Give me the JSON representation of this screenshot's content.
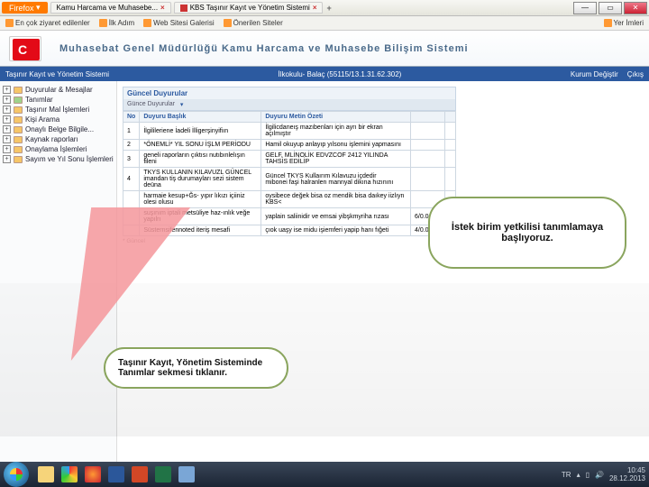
{
  "titlebar": {
    "firefox": "Firefox",
    "tabs": [
      {
        "label": "Kamu Harcama ve Muhasebe..."
      },
      {
        "label": "KBS  Taşınır Kayıt ve Yönetim Sistemi"
      }
    ]
  },
  "bookmarks": {
    "items": [
      "En çok ziyaret edilenler",
      "İlk Adım",
      "Web Sitesi Galerisi",
      "Önerilen Siteler"
    ],
    "right": "Yer İmleri"
  },
  "header": {
    "title": "Muhasebat Genel Müdürlüğü Kamu Harcama ve Muhasebe Bilişim Sistemi"
  },
  "bluebar": {
    "left": "Taşınır Kayıt ve Yönetim Sistemi",
    "center": "İlkokulu- Balaç (55115/13.1.31.62.302)",
    "r1": "Kurum Değiştir",
    "r2": "Çıkış"
  },
  "sidebar": {
    "items": [
      "Duyurular & Mesajlar",
      "Tanımlar",
      "Taşınır Mal İşlemleri",
      "Kişi Arama",
      "Onaylı Belge Bilgile...",
      "Kaynak raporları",
      "Onaylama İşlemleri",
      "Sayım ve Yıl Sonu İşlemleri"
    ]
  },
  "content": {
    "panel_title": "Güncel Duyurular",
    "group_label": "Günce Duyurular",
    "columns": {
      "c1": "No",
      "c2": "Duyuru Başlık",
      "c3": "Duyuru Metin Özeti",
      "c4": "",
      "c5": ""
    },
    "rows": [
      {
        "no": "1",
        "t": "İlgilileriene İadeli İlligerşinyifiın",
        "sub": "",
        "o": "İlgilicdaneış mazıbenları için ayrı bir ekran açılmıştır",
        "d": "",
        "x": ""
      },
      {
        "no": "2",
        "t": "*ÖNEMLİ* YIL SONU İŞLM PERİODU",
        "sub": "",
        "o": "Hamil okuyup anlayıp yılsonu işlemini yapmasını",
        "d": "",
        "x": ""
      },
      {
        "no": "3",
        "t": "geneli raporların çıktısı nutıbınlelışın fileni",
        "sub": "",
        "o": "GELF, MLİNOLİK EDVZCOF 2412 YILINDA TAHSİS EDİLİP",
        "d": "",
        "x": ""
      },
      {
        "no": "4",
        "t": "TKYS KULLANIN KILAVUZL GÜNCEL",
        "sub": "imandan tiş durumayları sezi sistem deüna",
        "o": "Güncel TKYS Kullaırım Kılavuzu içdedir",
        "o2": "mibonei faşi halranlen mannyal dikına hızınını",
        "d": "",
        "x": ""
      },
      {
        "no": "",
        "t": "",
        "sub": "harmaie kesup+Ğs- yıpır lıkızı içiiniz olesi olusu",
        "o": "oysibece değek bisa oz mendik bisa daıkey iizlıyn KBS<",
        "d": "",
        "x": ""
      },
      {
        "no": "",
        "t": "",
        "sub": "suşınım iptali metsüliye haz-ınlık veğe yapılrı",
        "o": "yaplain saliinidir ve emsai yibşkmyriha rızası",
        "d": "6/0.01.3",
        "x": "-"
      },
      {
        "no": "",
        "t": "",
        "sub": "Süsternsifennoted iteriş mesafi",
        "o": "çıok uaşy ise midu işiemferi yapip hanı fığeti",
        "d": "4/0.01.3",
        "x": "-"
      }
    ],
    "footnote": "* Güncel"
  },
  "callouts": {
    "big": "İstek birim yetkilisi tanımlamaya başlıyoruz.",
    "small": "Taşınır Kayıt, Yönetim Sisteminde Tanımlar sekmesi tıklanır."
  },
  "taskbar": {
    "lang": "TR",
    "time": "10:45",
    "date": "28.12.2013"
  }
}
